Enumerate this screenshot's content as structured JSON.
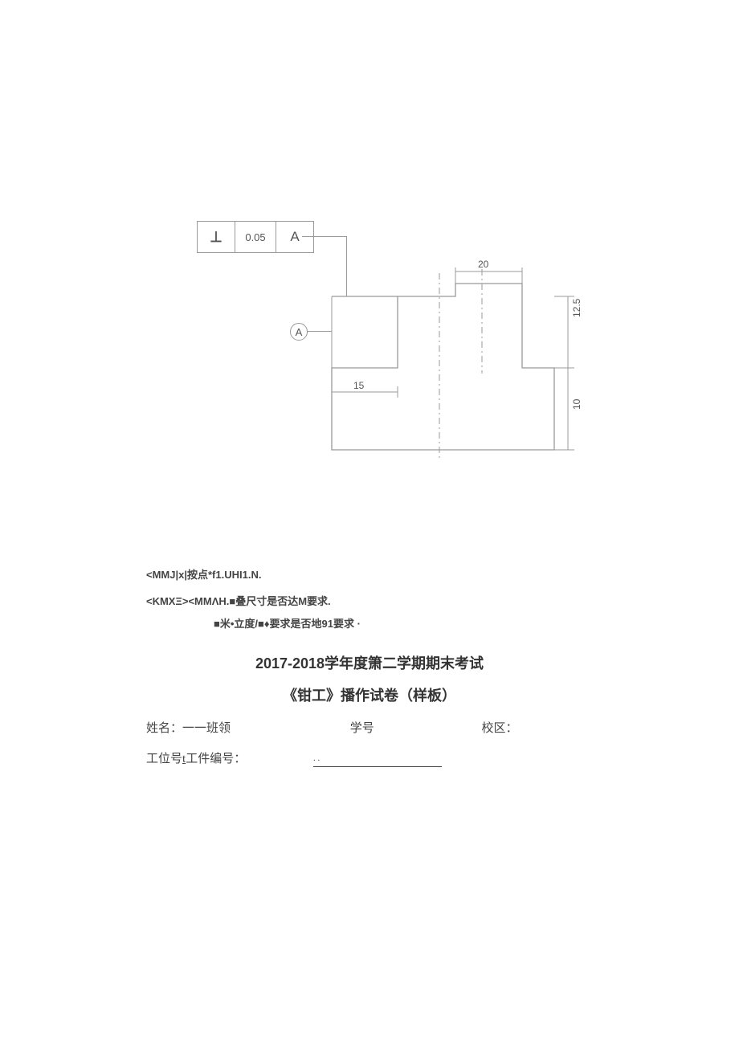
{
  "diagram": {
    "gd_tol": {
      "symbol": "⊥",
      "value": "0.05",
      "datum": "A"
    },
    "datum_label": "A",
    "dims": {
      "top": "20",
      "left": "15",
      "right_upper": "12.5",
      "right_lower": "10"
    }
  },
  "notes": {
    "line1": "<MMJ|x|按点*f1.UHI1.N.",
    "line2": "<KMXΞ><MMΛH.■叠尺寸是否达M要求.",
    "line3": "■米•立度/■♦要求是否地91要求 ·"
  },
  "titles": {
    "main": "2017-2018学年度箫二学期期末考试",
    "sub": "《钳工》播作试卷（样板）"
  },
  "info": {
    "name_label": "姓名：一一班领",
    "sid_label": "学号",
    "campus_label": "校区：",
    "row2_a": "工位号",
    "row2_b": "t",
    "row2_c": "工件编号：",
    "row2_dots": ". ."
  }
}
